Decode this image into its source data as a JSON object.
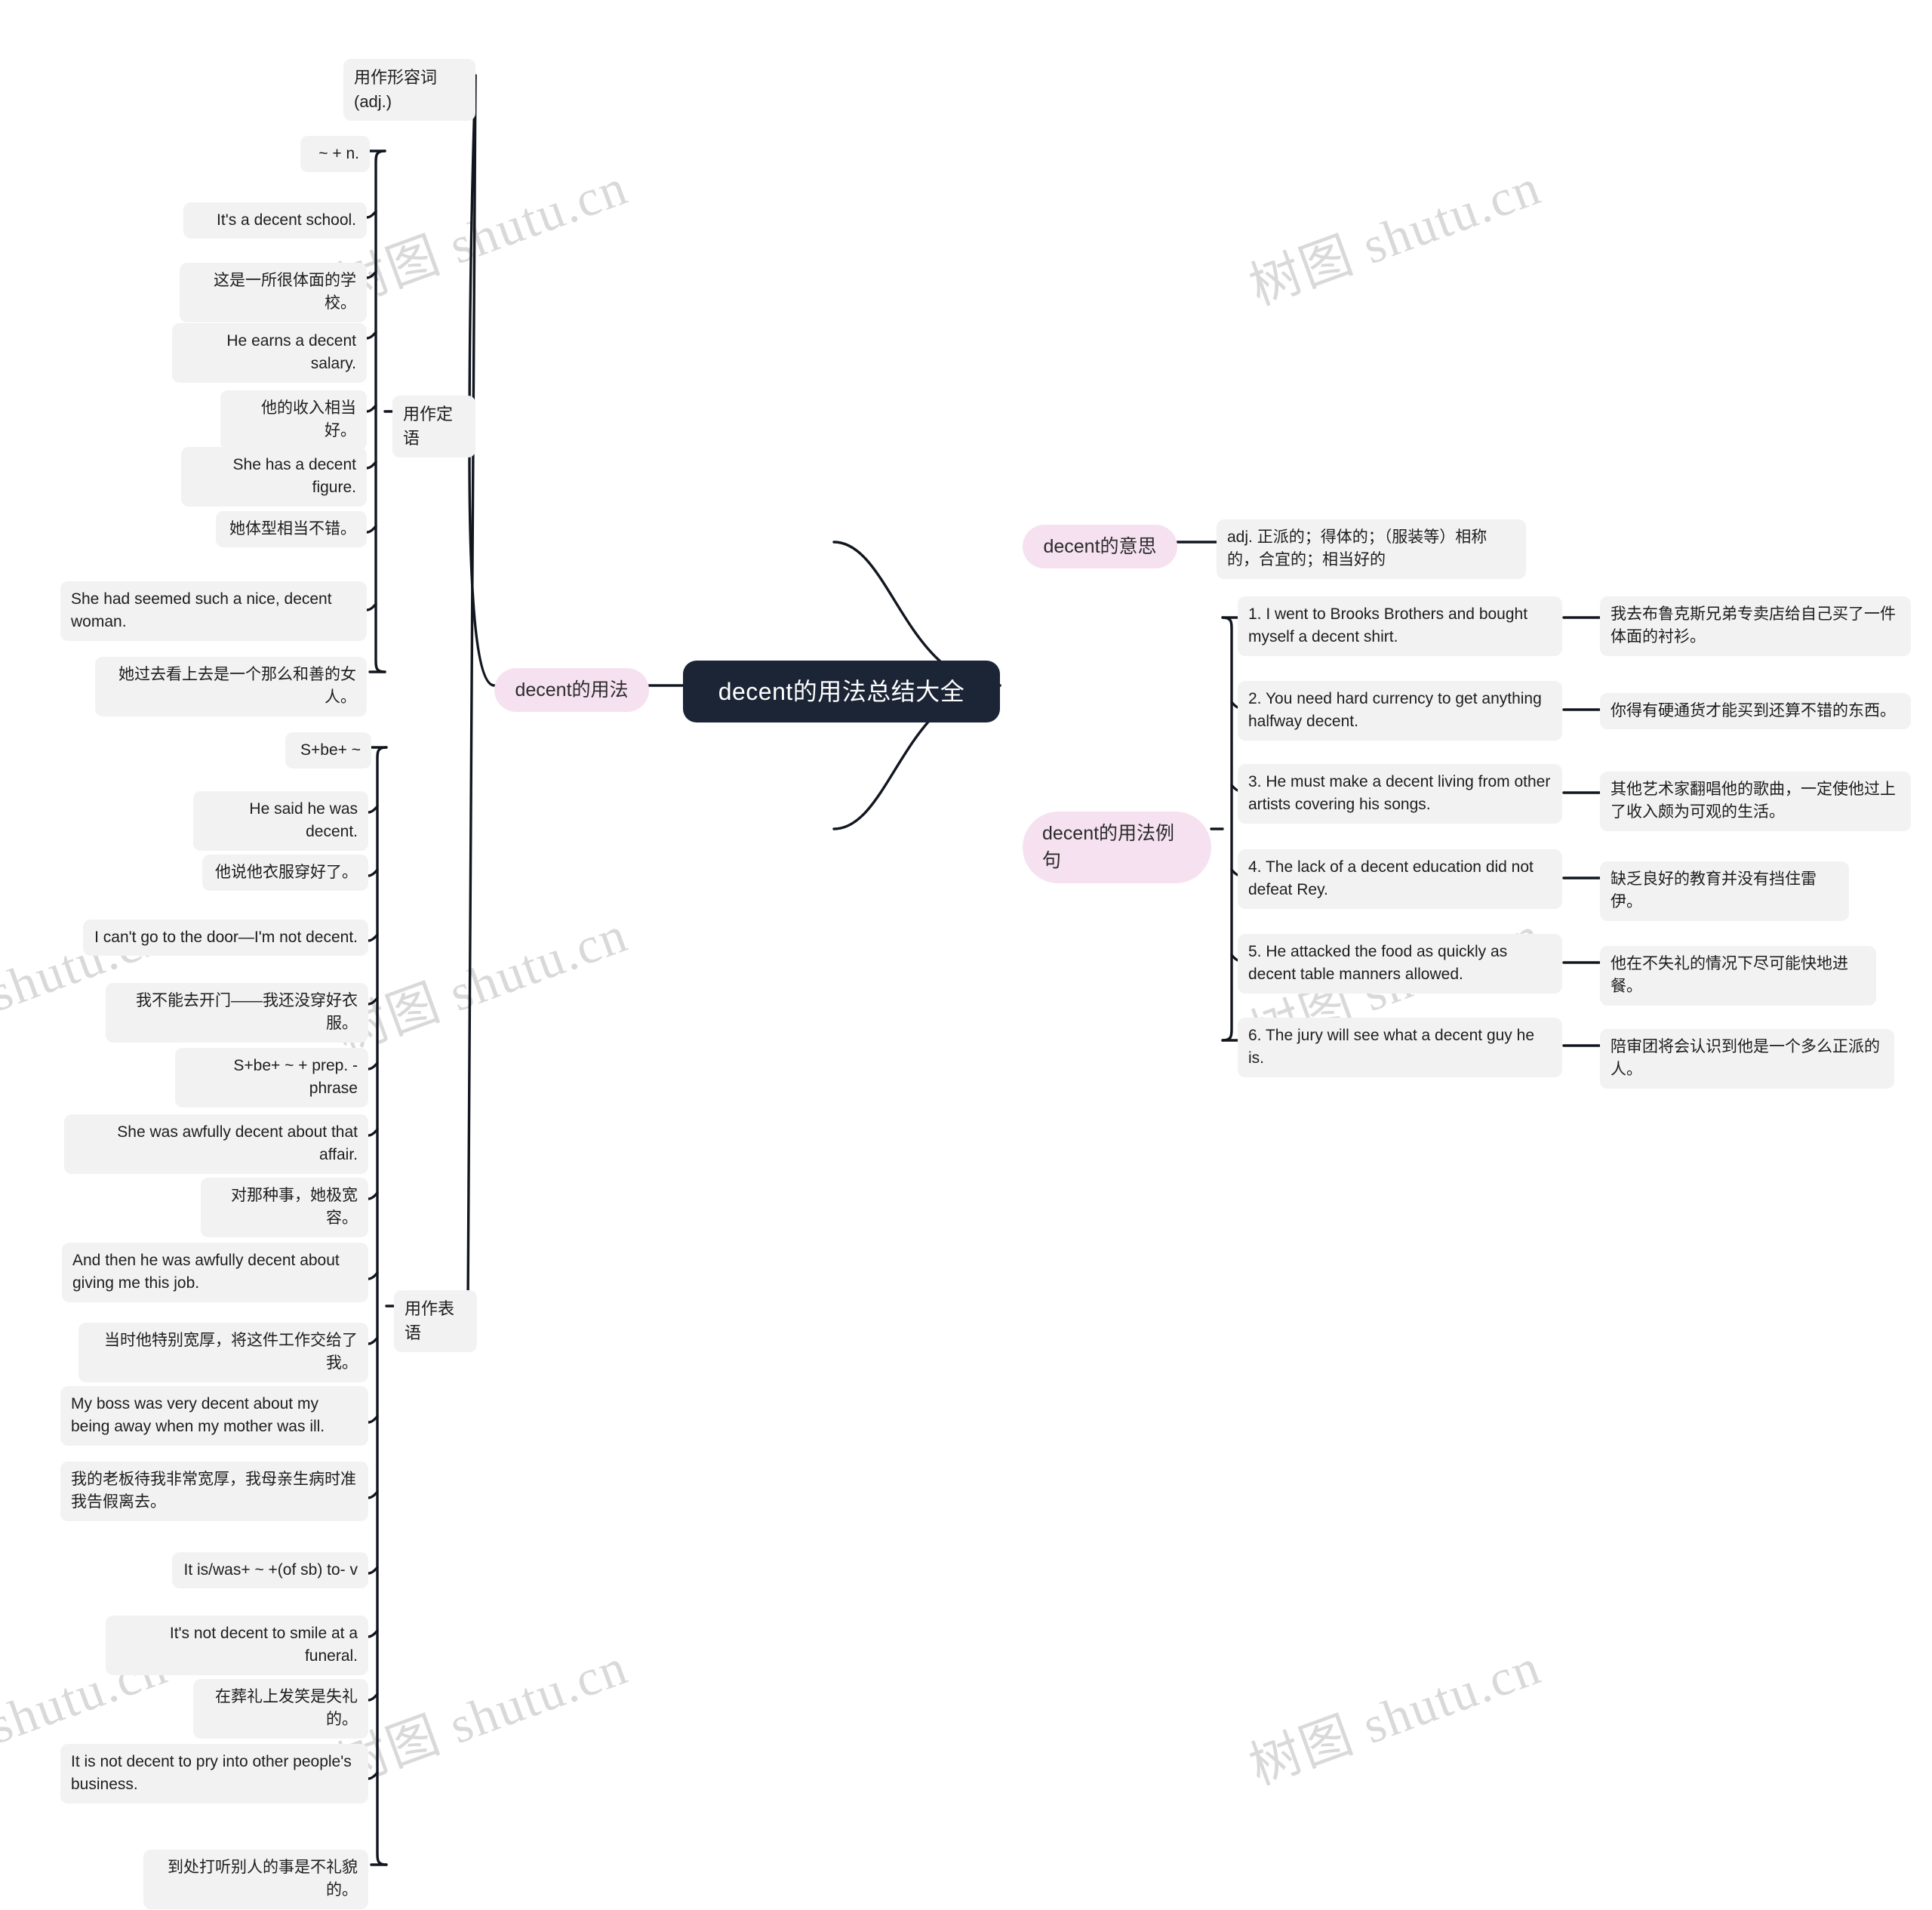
{
  "meta": {
    "watermark_text": "树图 shutu.cn",
    "colors": {
      "root_bg": "#1b2535",
      "root_text": "#ffffff",
      "pill_bg": "#f6e1f1",
      "leaf_bg": "#f2f2f2",
      "line": "#11161f",
      "watermark": "#d9d9d9",
      "page_bg": "#ffffff"
    }
  },
  "root": {
    "label": "decent的用法总结大全"
  },
  "branches": {
    "usage": {
      "label": "decent的用法",
      "adjective": {
        "label": "用作形容词(adj.)",
        "attributive": {
          "label": "用作定语",
          "items": [
            "~ + n.",
            "It's a decent school.",
            "这是一所很体面的学校。",
            "He earns a decent salary.",
            "他的收入相当好。",
            "She has a decent figure.",
            "她体型相当不错。",
            "She had seemed such a nice, decent woman.",
            "她过去看上去是一个那么和善的女人。"
          ]
        },
        "predicative": {
          "label": "用作表语",
          "items": [
            "S+be+ ~",
            "He said he was decent.",
            "他说他衣服穿好了。",
            "I can't go to the door—I'm not decent.",
            "我不能去开门——我还没穿好衣服。",
            "S+be+ ~ + prep. -phrase",
            "She was awfully decent about that affair.",
            "对那种事，她极宽容。",
            "And then he was awfully decent about giving me this job.",
            "当时他特别宽厚，将这件工作交给了我。",
            "My boss was very decent about my being away when my mother was ill.",
            "我的老板待我非常宽厚，我母亲生病时准我告假离去。",
            "It is/was+ ~ +(of sb) to- v",
            "It's not decent to smile at a funeral.",
            "在葬礼上发笑是失礼的。",
            "It is not decent to pry into other people's business.",
            "到处打听别人的事是不礼貌的。"
          ]
        }
      }
    },
    "meaning": {
      "label": "decent的意思",
      "definition": "adj. 正派的；得体的；（服装等）相称的，合宜的；相当好的"
    },
    "examples": {
      "label": "decent的用法例句",
      "rows": [
        {
          "en": "1. I went to Brooks Brothers and bought myself a decent shirt.",
          "zh": "我去布鲁克斯兄弟专卖店给自己买了一件体面的衬衫。"
        },
        {
          "en": "2. You need hard currency to get anything halfway decent.",
          "zh": "你得有硬通货才能买到还算不错的东西。"
        },
        {
          "en": "3. He must make a decent living from other artists covering his songs.",
          "zh": "其他艺术家翻唱他的歌曲，一定使他过上了收入颇为可观的生活。"
        },
        {
          "en": "4. The lack of a decent education did not defeat Rey.",
          "zh": "缺乏良好的教育并没有挡住雷伊。"
        },
        {
          "en": "5. He attacked the food as quickly as decent table manners allowed.",
          "zh": "他在不失礼的情况下尽可能快地进餐。"
        },
        {
          "en": "6. The jury will see what a decent guy he is.",
          "zh": "陪审团将会认识到他是一个多么正派的人。"
        }
      ]
    }
  }
}
